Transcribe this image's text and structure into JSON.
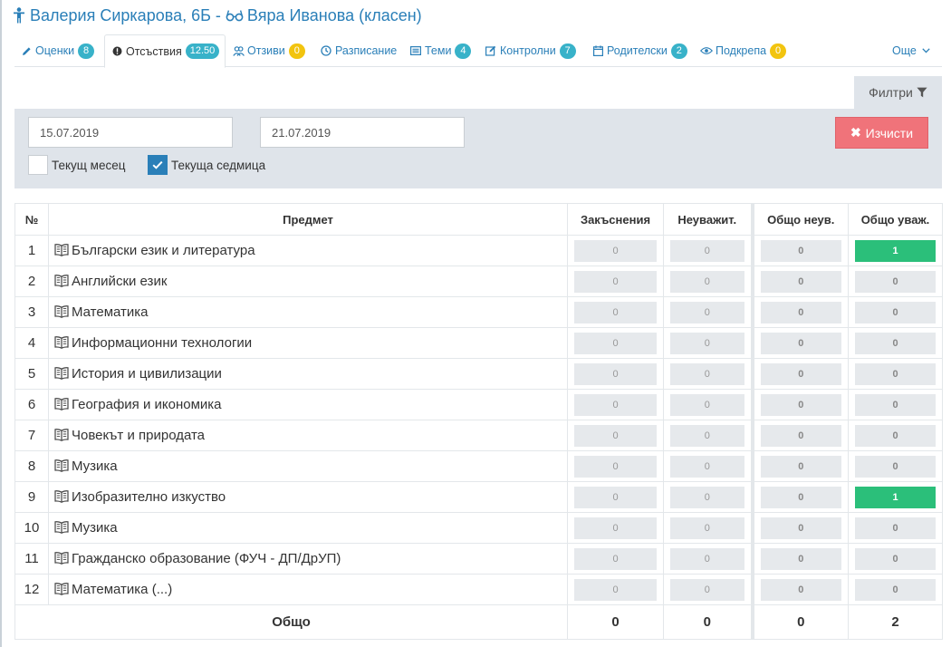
{
  "header": {
    "student": "Валерия Сиркарова, 6Б",
    "separator": "-",
    "teacher": "Вяра Иванова (класен)"
  },
  "tabs": [
    {
      "label": "Оценки",
      "badge": "8",
      "badge_color": "blue",
      "icon": "pencil-icon"
    },
    {
      "label": "Отсъствия",
      "badge": "12.50",
      "badge_color": "blue",
      "icon": "exclamation-circle-icon",
      "active": true
    },
    {
      "label": "Отзиви",
      "badge": "0",
      "badge_color": "yellow",
      "icon": "people-icon"
    },
    {
      "label": "Разписание",
      "icon": "clock-icon"
    },
    {
      "label": "Теми",
      "badge": "4",
      "badge_color": "blue",
      "icon": "list-icon"
    },
    {
      "label": "Контролни",
      "badge": "7",
      "badge_color": "blue",
      "icon": "edit-icon"
    },
    {
      "label": "Родителски",
      "badge": "2",
      "badge_color": "blue",
      "icon": "calendar-icon"
    },
    {
      "label": "Подкрепа",
      "badge": "0",
      "badge_color": "yellow",
      "icon": "eye-icon"
    }
  ],
  "more_label": "Още",
  "filters": {
    "tab_label": "Филтри",
    "date_from": "15.07.2019",
    "date_to": "21.07.2019",
    "current_month_label": "Текущ месец",
    "current_month_checked": false,
    "current_week_label": "Текуща седмица",
    "current_week_checked": true,
    "clear_label": "Изчисти"
  },
  "table": {
    "headers": {
      "num": "№",
      "subject": "Предмет",
      "late": "Закъснения",
      "unexcused": "Неуважит.",
      "total_unexcused": "Общо неув.",
      "total_excused": "Общо уваж."
    },
    "rows": [
      {
        "num": "1",
        "subject": "Български език и литература",
        "late": "0",
        "unexcused": "0",
        "total_unexcused": "0",
        "total_excused": "1"
      },
      {
        "num": "2",
        "subject": "Английски език",
        "late": "0",
        "unexcused": "0",
        "total_unexcused": "0",
        "total_excused": "0"
      },
      {
        "num": "3",
        "subject": "Математика",
        "late": "0",
        "unexcused": "0",
        "total_unexcused": "0",
        "total_excused": "0"
      },
      {
        "num": "4",
        "subject": "Информационни технологии",
        "late": "0",
        "unexcused": "0",
        "total_unexcused": "0",
        "total_excused": "0"
      },
      {
        "num": "5",
        "subject": "История и цивилизации",
        "late": "0",
        "unexcused": "0",
        "total_unexcused": "0",
        "total_excused": "0"
      },
      {
        "num": "6",
        "subject": "География и икономика",
        "late": "0",
        "unexcused": "0",
        "total_unexcused": "0",
        "total_excused": "0"
      },
      {
        "num": "7",
        "subject": "Човекът и природата",
        "late": "0",
        "unexcused": "0",
        "total_unexcused": "0",
        "total_excused": "0"
      },
      {
        "num": "8",
        "subject": "Музика",
        "late": "0",
        "unexcused": "0",
        "total_unexcused": "0",
        "total_excused": "0"
      },
      {
        "num": "9",
        "subject": "Изобразително изкуство",
        "late": "0",
        "unexcused": "0",
        "total_unexcused": "0",
        "total_excused": "1"
      },
      {
        "num": "10",
        "subject": "Музика",
        "late": "0",
        "unexcused": "0",
        "total_unexcused": "0",
        "total_excused": "0"
      },
      {
        "num": "11",
        "subject": "Гражданско образование (ФУЧ - ДП/ДрУП)",
        "late": "0",
        "unexcused": "0",
        "total_unexcused": "0",
        "total_excused": "0"
      },
      {
        "num": "12",
        "subject": "Математика (...)",
        "late": "0",
        "unexcused": "0",
        "total_unexcused": "0",
        "total_excused": "0"
      }
    ],
    "totals": {
      "label": "Общо",
      "late": "0",
      "unexcused": "0",
      "total_unexcused": "0",
      "total_excused": "2"
    }
  },
  "colors": {
    "accent": "#2a7fb8",
    "badge_blue": "#38b2c9",
    "badge_yellow": "#f2c40f",
    "excused_green": "#2bbf7a",
    "clear_button": "#f0737a",
    "filter_panel": "#dfe4ea"
  }
}
